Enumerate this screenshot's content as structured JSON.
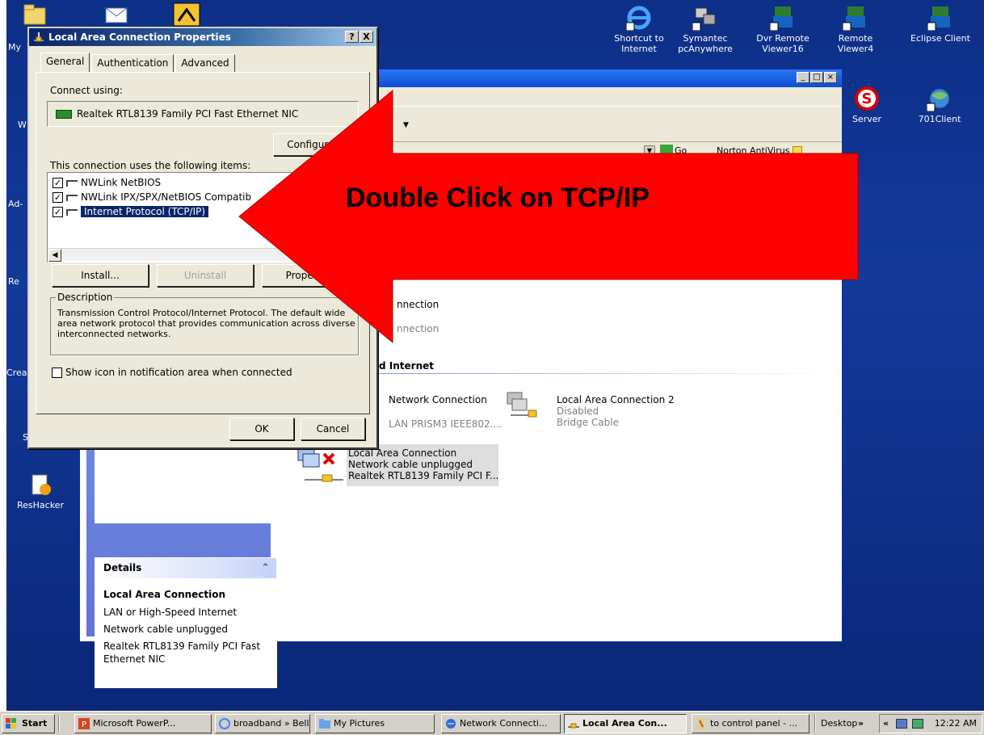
{
  "desktop": {
    "right_icons": [
      {
        "label": "Shortcut to Internet",
        "icon": "internet-explorer-icon"
      },
      {
        "label": "Symantec pcAnywhere",
        "icon": "pcanywhere-icon"
      },
      {
        "label": "Dvr Remote Viewer16",
        "icon": "dvr-viewer-icon"
      },
      {
        "label": "Remote Viewer4",
        "icon": "remote-viewer-icon"
      },
      {
        "label": "Eclipse Client",
        "icon": "eclipse-client-icon"
      },
      {
        "label": "Server",
        "icon": "server-icon"
      },
      {
        "label": "701Client",
        "icon": "client-icon"
      }
    ],
    "left_fragments": [
      "My",
      "W",
      "Ad-",
      "Re",
      "Crea",
      "S"
    ],
    "resHacker": "ResHacker"
  },
  "network_window": {
    "groups": {
      "internet_partial": "d Internet"
    },
    "connections": {
      "partial1_line1": "nnection",
      "partial1_line2": "nnection",
      "wireless_name": "Network Connection",
      "wireless_sub": "LAN PRISM3 IEEE802....",
      "lac2_name": "Local Area Connection 2",
      "lac2_status": "Disabled",
      "lac2_type": "Bridge Cable",
      "lac_name": "Local Area Connection",
      "lac_status": "Network cable unplugged",
      "lac_device": "Realtek RTL8139 Family PCI F..."
    },
    "toolbar": {
      "go": "Go",
      "norton": "Norton AntiVirus"
    },
    "details": {
      "header": "Details",
      "title": "Local Area Connection",
      "line1": "LAN or High-Speed Internet",
      "line2": "Network cable unplugged",
      "line3": "Realtek RTL8139 Family PCI Fast Ethernet NIC"
    }
  },
  "dialog": {
    "title": "Local Area Connection Properties",
    "help": "?",
    "close": "X",
    "tabs": [
      "General",
      "Authentication",
      "Advanced"
    ],
    "connect_using_label": "Connect using:",
    "adapter": "Realtek RTL8139 Family PCI Fast Ethernet NIC",
    "configure": "Configure...",
    "items_label": "This connection uses the following items:",
    "items": [
      {
        "label": "NWLink NetBIOS",
        "checked": true
      },
      {
        "label": "NWLink IPX/SPX/NetBIOS Compatib",
        "checked": true
      },
      {
        "label": "Internet Protocol (TCP/IP)",
        "checked": true,
        "selected": true
      }
    ],
    "install": "Install...",
    "uninstall": "Uninstall",
    "properties": "Properties",
    "description_legend": "Description",
    "description": "Transmission Control Protocol/Internet Protocol. The default wide area network protocol that provides communication across diverse interconnected networks.",
    "show_icon": "Show icon in notification area when connected",
    "ok": "OK",
    "cancel": "Cancel"
  },
  "callout": {
    "text": "Double Click on TCP/IP",
    "color": "#ff0000"
  },
  "taskbar": {
    "start": "Start",
    "buttons": [
      "Microsoft PowerP...",
      "broadband » Bell...",
      "My Pictures",
      "Network Connecti...",
      "Local Area Con...",
      "to control panel - ..."
    ],
    "desktop": "Desktop",
    "time": "12:22 AM"
  }
}
